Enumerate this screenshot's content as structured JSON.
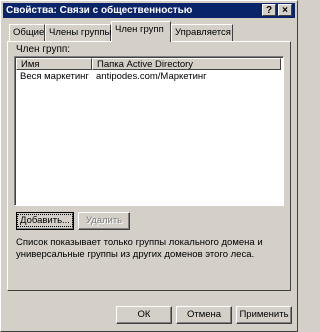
{
  "window": {
    "title": "Свойства: Связи с общественностью",
    "help_button": "?",
    "close_button": "×"
  },
  "tabs": [
    {
      "label": "Общие"
    },
    {
      "label": "Члены группы"
    },
    {
      "label": "Член групп",
      "active": true
    },
    {
      "label": "Управляется"
    }
  ],
  "member_of": {
    "label": "Член групп:",
    "columns": [
      "Имя",
      "Папка Active Directory"
    ],
    "rows": [
      {
        "name": "Веся маркетинг",
        "folder": "antipodes.com/Маркетинг"
      }
    ]
  },
  "buttons": {
    "add": "Добавить...",
    "remove": "Удалить",
    "ok": "ОК",
    "cancel": "Отмена",
    "apply": "Применить"
  },
  "note": "Список показывает только группы локального домена и универсальные группы из других доменов этого леса."
}
